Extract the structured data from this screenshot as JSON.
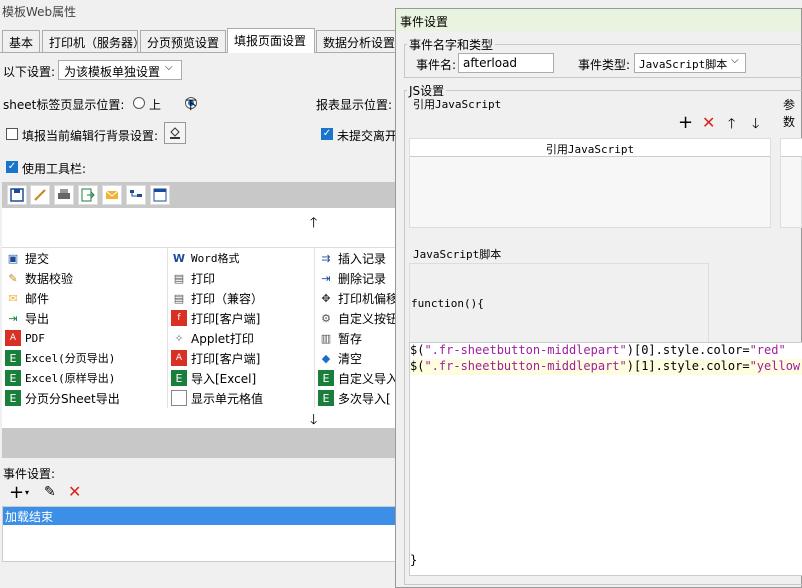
{
  "left": {
    "window_title": "模板Web属性",
    "tabs": [
      "基本",
      "打印机（服务器）",
      "分页预览设置",
      "填报页面设置",
      "数据分析设置"
    ],
    "settings_label": "以下设置:",
    "settings_value": "为该模板单独设置",
    "sheet_tab_label": "sheet标签页显示位置:",
    "radio_top": "上",
    "radio_bottom": "下",
    "report_pos_label": "报表显示位置:",
    "bg_setting_label": "填报当前编辑行背景设置:",
    "unsubmitted_label": "未提交离开",
    "use_toolbar_label": "使用工具栏:",
    "buttons_col1": [
      "提交",
      "数据校验",
      "邮件",
      "导出",
      "PDF",
      "Excel(分页导出)",
      "Excel(原样导出)",
      "分页分Sheet导出"
    ],
    "buttons_col2": [
      "Word格式",
      "打印",
      "打印（兼容）",
      "打印[客户端]",
      "Applet打印",
      "打印[客户端]",
      "导入[Excel]",
      "显示单元格值"
    ],
    "buttons_col3": [
      "插入记录",
      "删除记录",
      "打印机偏移",
      "自定义按钮",
      "暂存",
      "清空",
      "自定义导入",
      "多次导入["
    ],
    "event_settings_label": "事件设置:",
    "event_item": "加载结束"
  },
  "dialog": {
    "title": "事件设置",
    "name_group_title": "事件名字和类型",
    "event_name_label": "事件名:",
    "event_name_value": "afterload",
    "event_type_label": "事件类型:",
    "event_type_value": "JavaScript脚本",
    "js_group_title": "JS设置",
    "ref_js_label": "引用JavaScript",
    "params_label": "参数",
    "ref_js_col_header": "引用JavaScript",
    "js_script_label": "JavaScript脚本",
    "code_header": "function(){",
    "code_lines": [
      {
        "a": "$(",
        "b": "\".fr-sheetbutton-middlepart\"",
        "c": ")[0].style.color=",
        "d": "\"red\""
      },
      {
        "a": "$(",
        "b": "\".fr-sheetbutton-middlepart\"",
        "c": ")[1].style.color=",
        "d": "\"yellow\""
      }
    ],
    "code_footer": "}"
  }
}
